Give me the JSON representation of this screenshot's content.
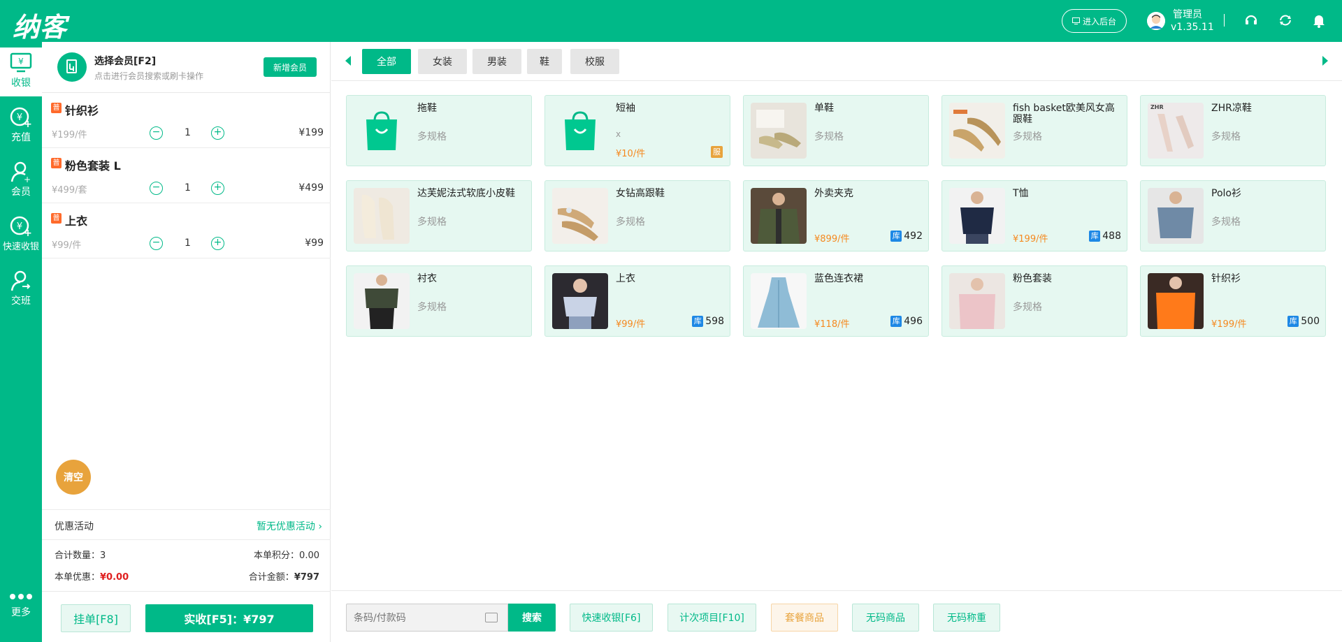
{
  "app": {
    "logo": "纳客",
    "admin_button": "进入后台",
    "user_name": "管理员",
    "version": "v1.35.11"
  },
  "colors": {
    "primary": "#00b988",
    "orange": "#e8a33c",
    "price": "#f5891f",
    "stock": "#1e88e5",
    "red": "#e02020"
  },
  "nav": {
    "items": [
      {
        "label": "收银",
        "icon": "cashier-icon",
        "active": true
      },
      {
        "label": "充值",
        "icon": "recharge-icon"
      },
      {
        "label": "会员",
        "icon": "member-icon"
      },
      {
        "label": "快速收银",
        "icon": "quick-cashier-icon"
      },
      {
        "label": "交班",
        "icon": "handover-icon"
      }
    ],
    "more": "更多"
  },
  "member": {
    "title": "选择会员[F2]",
    "subtitle": "点击进行会员搜索或刷卡操作",
    "new_button": "新增会员"
  },
  "cart": {
    "items": [
      {
        "tag": "普",
        "name": "针织衫",
        "unit_price": "¥199/件",
        "qty": "1",
        "total": "¥199"
      },
      {
        "tag": "普",
        "name": "粉色套装 L",
        "unit_price": "¥499/套",
        "qty": "1",
        "total": "¥499"
      },
      {
        "tag": "普",
        "name": "上衣",
        "unit_price": "¥99/件",
        "qty": "1",
        "total": "¥99"
      }
    ],
    "clear_button": "清空",
    "promo_label": "优惠活动",
    "promo_value": "暂无优惠活动",
    "total_qty_label": "合计数量：",
    "total_qty": "3",
    "points_label": "本单积分：",
    "points": "0.00",
    "discount_label": "本单优惠：",
    "discount": "¥0.00",
    "amount_label": "合计金额：",
    "amount": "¥797",
    "hold_button": "挂单[F8]",
    "pay_button": "实收[F5]：¥797"
  },
  "tabs": [
    "全部",
    "女装",
    "男装",
    "鞋",
    "校服"
  ],
  "products": [
    {
      "name": "拖鞋",
      "spec": "多规格",
      "image": "shopping-bag-icon"
    },
    {
      "name": "短袖",
      "spec": "x",
      "price": "¥10/件",
      "badge": "服",
      "image": "shopping-bag-icon"
    },
    {
      "name": "单鞋",
      "spec": "多规格",
      "image": "flat-shoe-photo"
    },
    {
      "name": "fish basket欧美风女高跟鞋",
      "spec": "多规格",
      "image": "high-heel-photo"
    },
    {
      "name": "ZHR凉鞋",
      "spec": "多规格",
      "image": "sandal-photo"
    },
    {
      "name": "达芙妮法式软底小皮鞋",
      "spec": "多规格",
      "image": "loafer-photo"
    },
    {
      "name": "女钻高跟鞋",
      "spec": "多规格",
      "image": "diamond-heel-photo"
    },
    {
      "name": "外卖夹克",
      "price": "¥899/件",
      "stock": "492",
      "image": "jacket-photo"
    },
    {
      "name": "T恤",
      "price": "¥199/件",
      "stock": "488",
      "image": "tshirt-photo"
    },
    {
      "name": "Polo衫",
      "spec": "多规格",
      "image": "polo-photo"
    },
    {
      "name": "衬衣",
      "spec": "多规格",
      "image": "shirt-photo"
    },
    {
      "name": "上衣",
      "price": "¥99/件",
      "stock": "598",
      "image": "top-photo"
    },
    {
      "name": "蓝色连衣裙",
      "price": "¥118/件",
      "stock": "496",
      "image": "dress-photo"
    },
    {
      "name": "粉色套装",
      "spec": "多规格",
      "image": "pink-suit-photo"
    },
    {
      "name": "针织衫",
      "price": "¥199/件",
      "stock": "500",
      "image": "sweater-photo"
    }
  ],
  "stock_badge": "库",
  "bottom": {
    "search_placeholder": "条码/付款码",
    "search_button": "搜索",
    "buttons": [
      "快速收银[F6]",
      "计次项目[F10]",
      "套餐商品",
      "无码商品",
      "无码称重"
    ]
  }
}
